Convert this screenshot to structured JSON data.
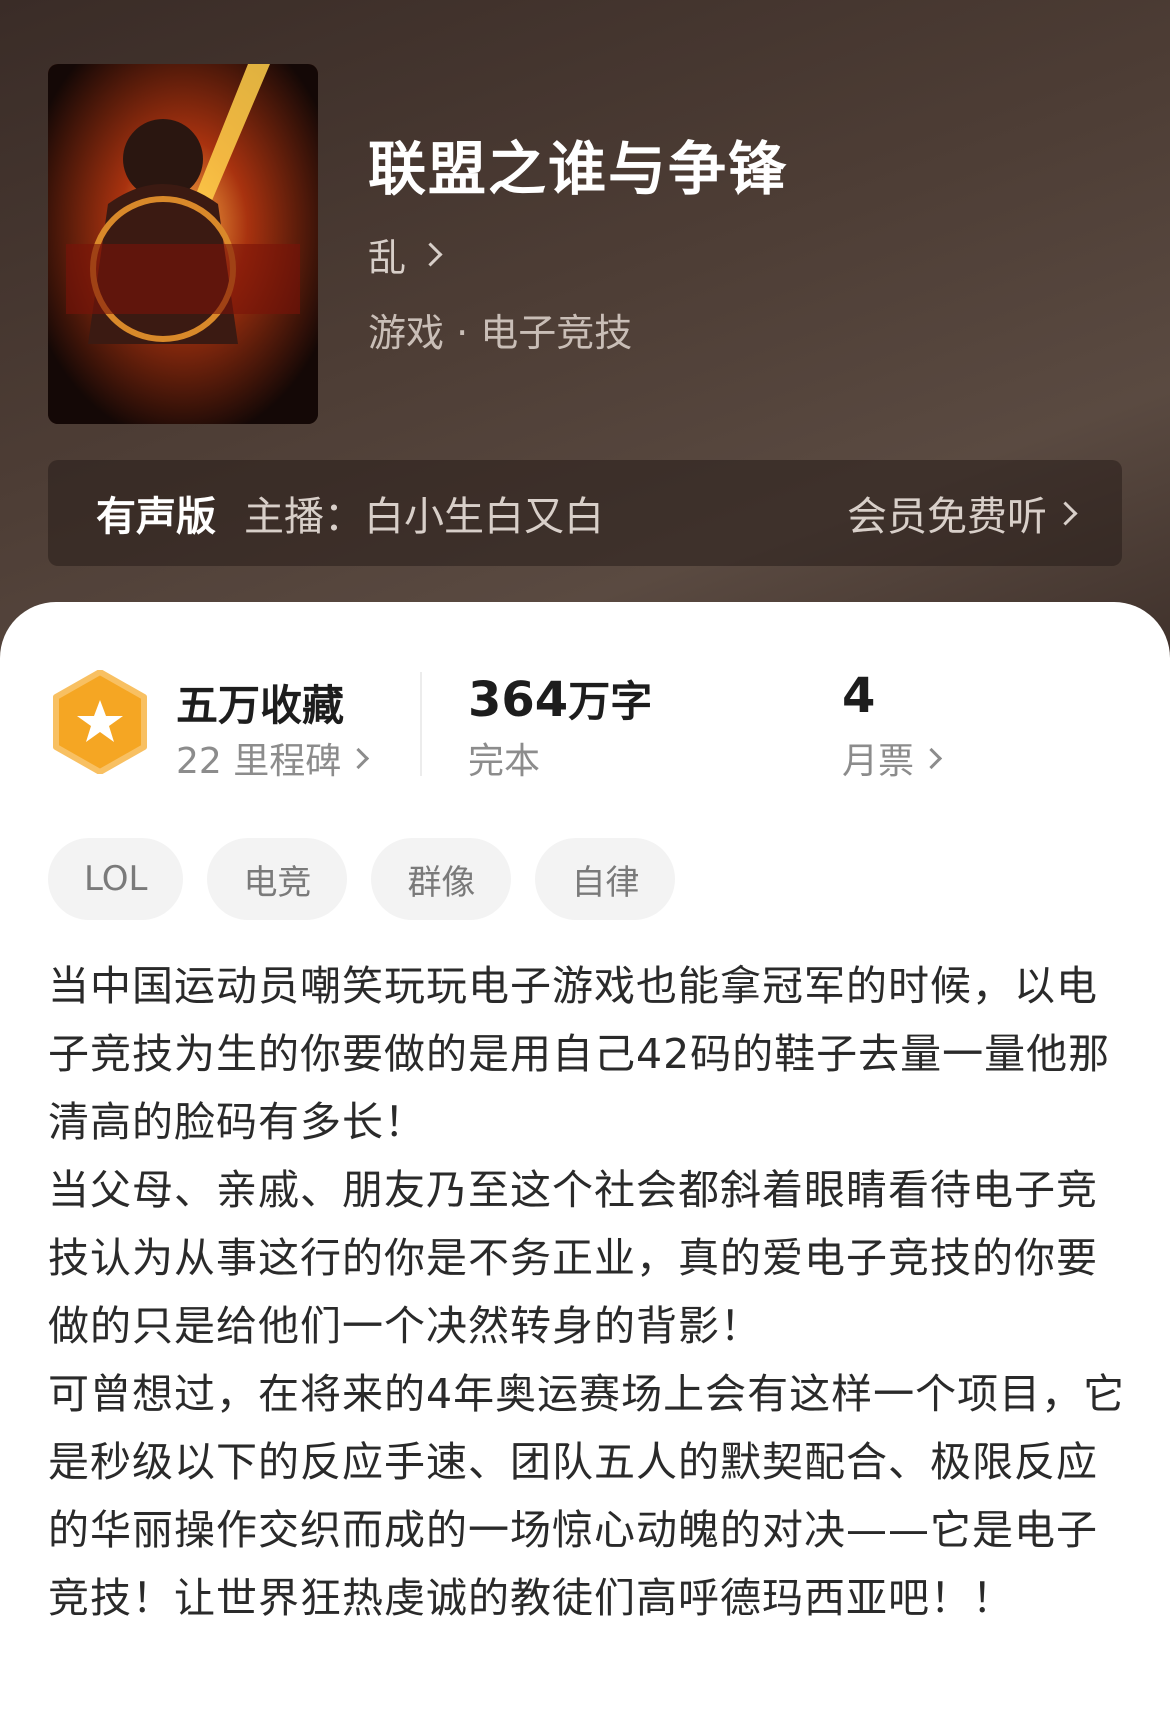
{
  "book": {
    "title": "联盟之谁与争锋",
    "author": "乱",
    "genre": "游戏 · 电子竞技"
  },
  "audio": {
    "badge": "有声版",
    "host": "主播：白小生白又白",
    "cta": "会员免费听"
  },
  "stats": {
    "favorites": "五万收藏",
    "milestones": "22 里程碑",
    "word_count_number": "364",
    "word_count_unit": "万字",
    "status": "完本",
    "monthly_votes": "4",
    "monthly_votes_label": "月票"
  },
  "tags": [
    "LOL",
    "电竞",
    "群像",
    "自律"
  ],
  "description": [
    "当中国运动员嘲笑玩玩电子游戏也能拿冠军的时候，以电子竞技为生的你要做的是用自己42码的鞋子去量一量他那清高的脸码有多长！",
    "当父母、亲戚、朋友乃至这个社会都斜着眼睛看待电子竞技认为从事这行的你是不务正业，真的爱电子竞技的你要做的只是给他们一个决然转身的背影！",
    "可曾想过，在将来的4年奥运赛场上会有这样一个项目，它是秒级以下的反应手速、团队五人的默契配合、极限反应的华丽操作交织而成的一场惊心动魄的对决——它是电子竞技！让世界狂热虔诚的教徒们高呼德玛西亚吧！！"
  ],
  "colors": {
    "header_bg": "#4a3a33",
    "badge_orange": "#f5a623",
    "text_primary": "#1d1d1d",
    "text_secondary": "#8c8c8c"
  }
}
